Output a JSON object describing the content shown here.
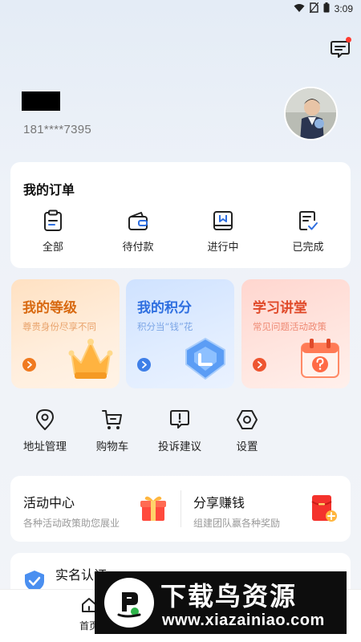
{
  "status_bar": {
    "time": "3:09",
    "icons": [
      "wifi-icon",
      "no-sim-icon",
      "battery-icon"
    ]
  },
  "header": {
    "message_icon": "message-icon",
    "user_name": "",
    "phone": "181****7395"
  },
  "orders": {
    "title": "我的订单",
    "items": [
      {
        "label": "全部",
        "icon": "clipboard-icon"
      },
      {
        "label": "待付款",
        "icon": "wallet-icon"
      },
      {
        "label": "进行中",
        "icon": "bookmark-box-icon"
      },
      {
        "label": "已完成",
        "icon": "checked-document-icon"
      }
    ]
  },
  "feature_cards": [
    {
      "title": "我的等级",
      "subtitle": "尊贵身份尽享不同",
      "icon": "crown-icon",
      "color": "#f07a20"
    },
    {
      "title": "我的积分",
      "subtitle": "积分当“钱”花",
      "icon": "points-shield-icon",
      "color": "#3f7fe8"
    },
    {
      "title": "学习讲堂",
      "subtitle": "常见问题活动政策",
      "icon": "calendar-question-icon",
      "color": "#ee5530"
    }
  ],
  "quick_links": [
    {
      "label": "地址管理",
      "icon": "location-pin-icon"
    },
    {
      "label": "购物车",
      "icon": "shopping-cart-icon"
    },
    {
      "label": "投诉建议",
      "icon": "feedback-icon"
    },
    {
      "label": "设置",
      "icon": "settings-hexagon-icon"
    }
  ],
  "activity": {
    "left": {
      "title": "活动中心",
      "subtitle": "各种活动政策助您展业",
      "icon": "gift-box-icon"
    },
    "right": {
      "title": "分享赚钱",
      "subtitle": "组建团队赢各种奖励",
      "icon": "red-envelope-icon"
    }
  },
  "verify": {
    "title": "实名认证",
    "icon": "verified-shield-icon"
  },
  "tabbar": {
    "home_label": "首页",
    "home_icon": "home-icon"
  },
  "watermark": {
    "title": "下载鸟资源",
    "url": "www.xiazainiao.com"
  }
}
